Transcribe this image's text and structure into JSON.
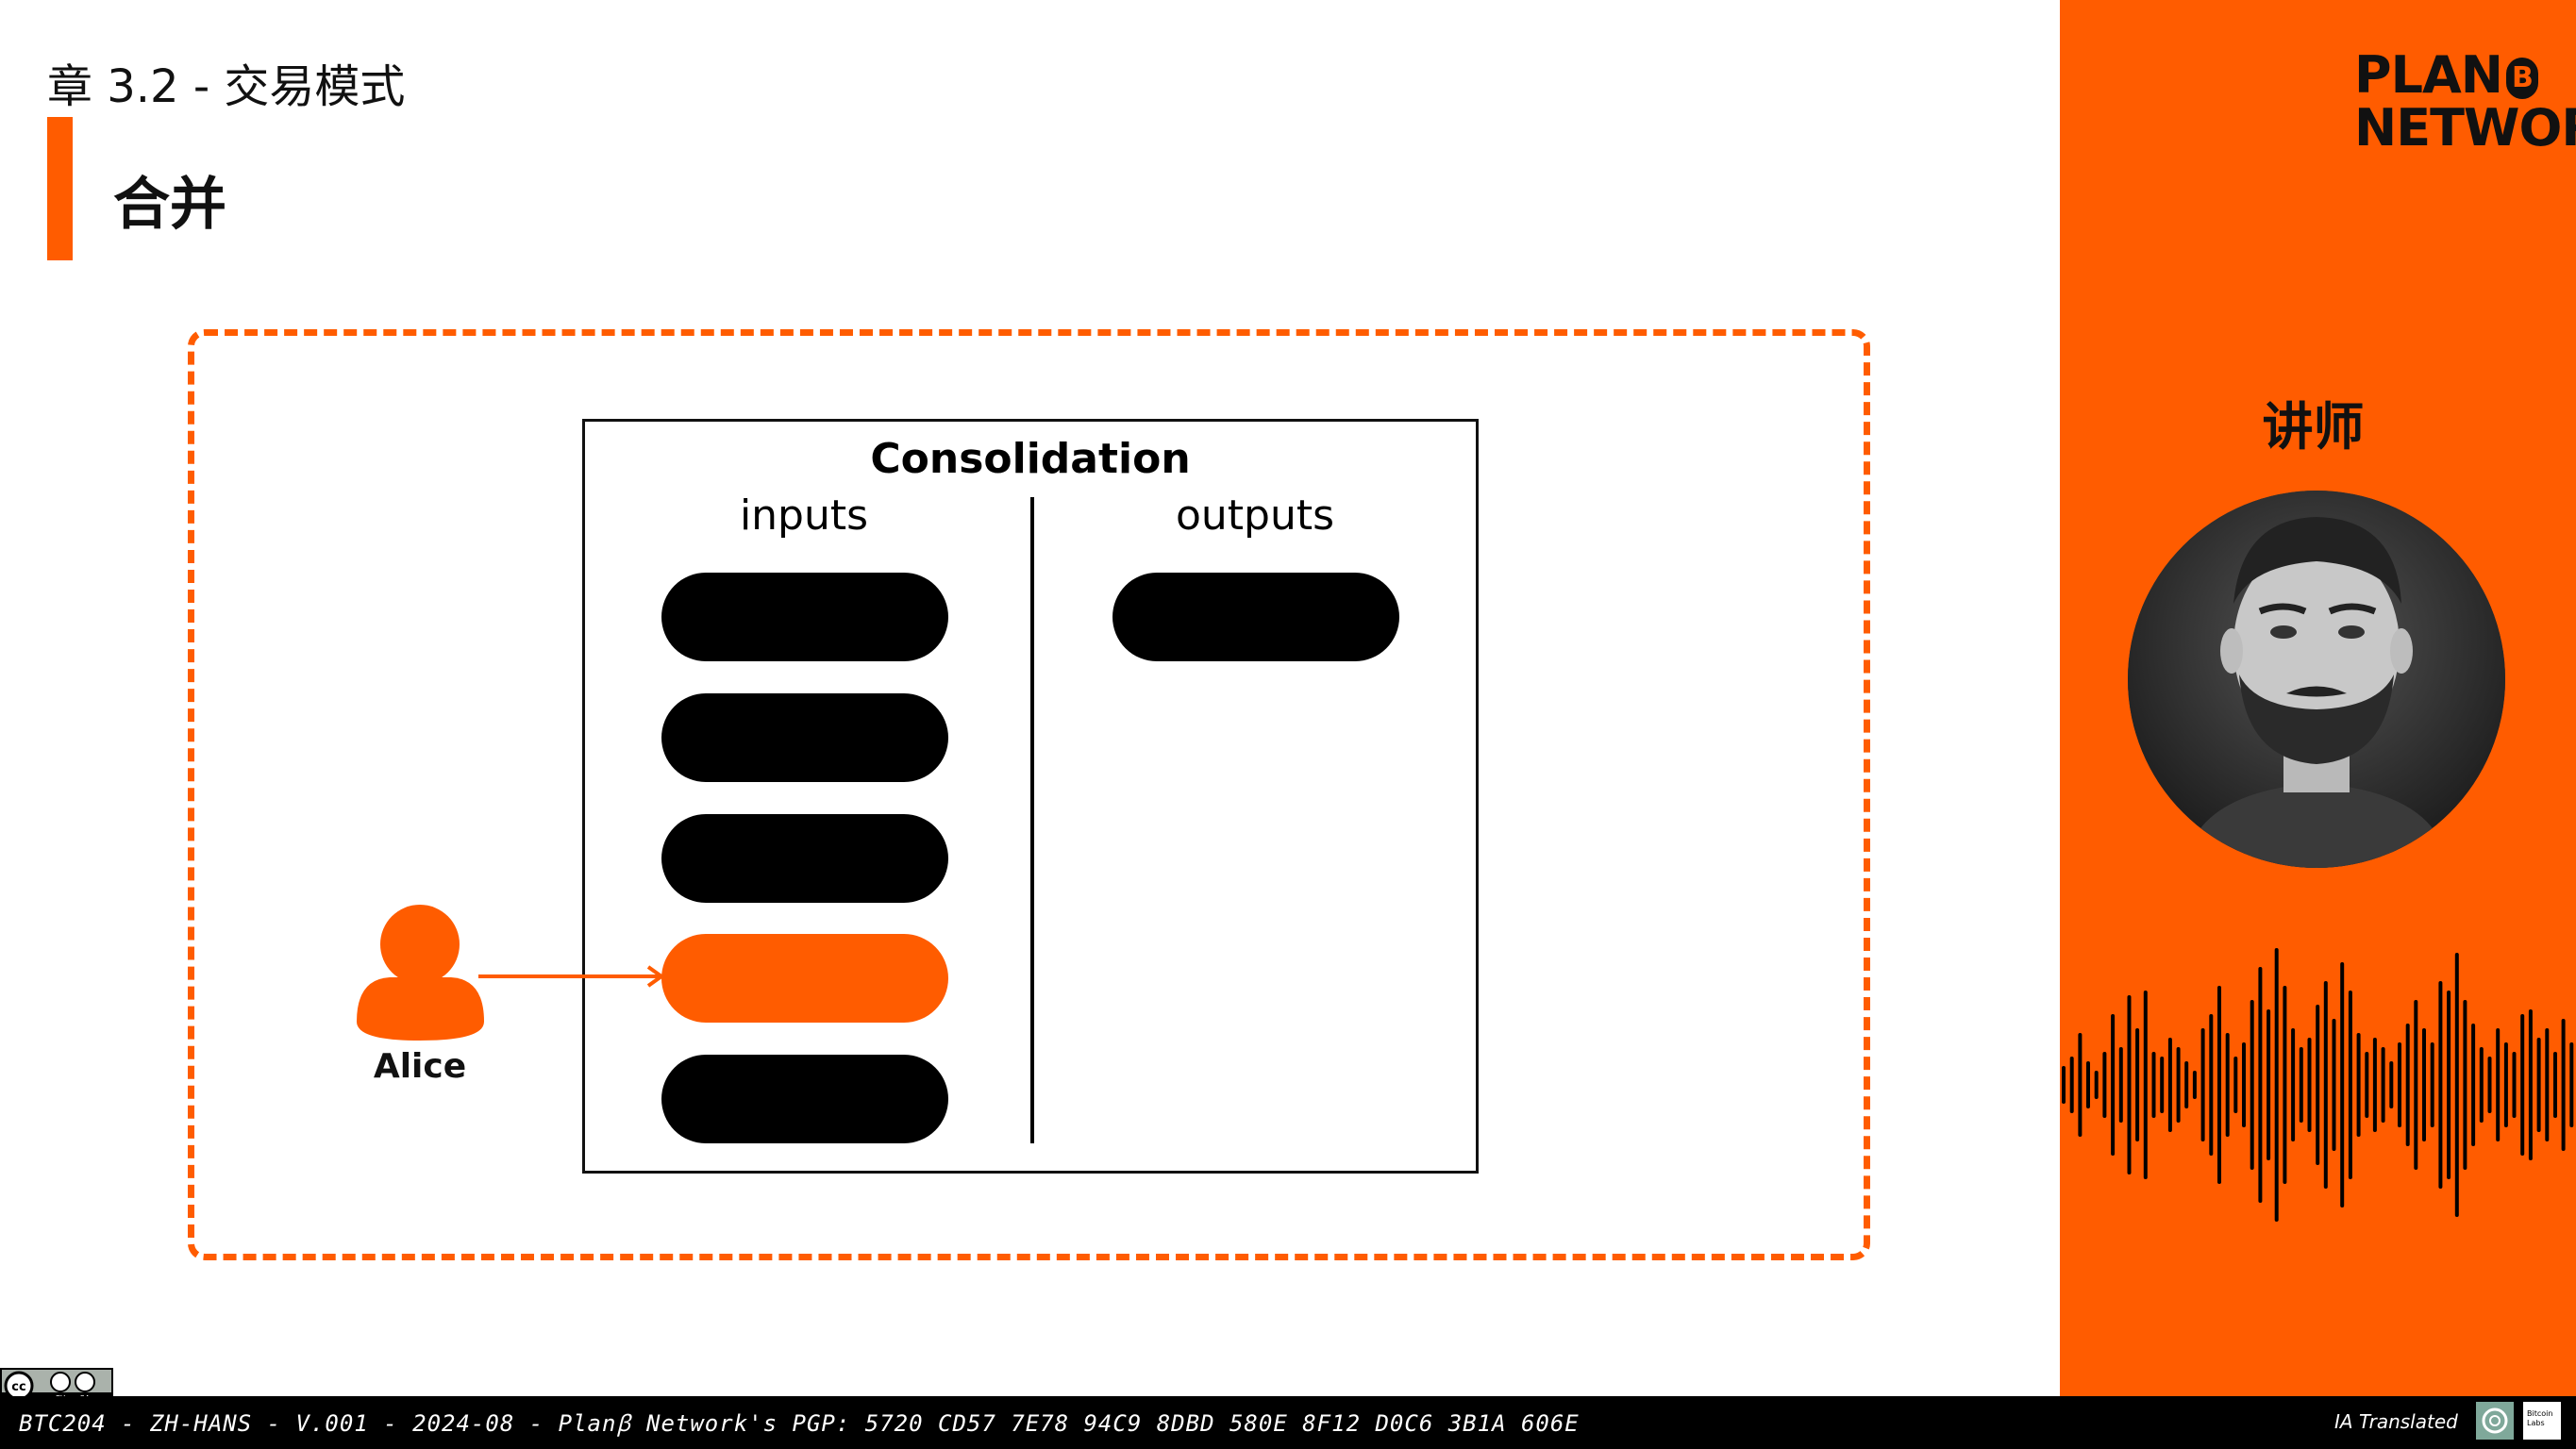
{
  "slide": {
    "chapter": "章 3.2 - 交易模式",
    "section_title": "合并"
  },
  "diagram": {
    "box_title": "Consolidation",
    "inputs_label": "inputs",
    "outputs_label": "outputs",
    "input_count": 5,
    "output_count": 1,
    "highlighted_input_index": 3,
    "owner_name": "Alice",
    "accent_color": "#ff5c00",
    "utxo_color": "#000000"
  },
  "sidebar": {
    "logo_line1": "PLAN",
    "logo_b": "B",
    "logo_line2": "NETWORK",
    "instructor_label": "讲师",
    "background_color": "#ff5c00"
  },
  "footer": {
    "text": "BTC204 - ZH-HANS - V.001 - 2024-08 - Planꞵ Network's PGP: 5720 CD57 7E78 94C9 8DBD 580E 8F12 D0C6 3B1A 606E",
    "ia_text": "IA Translated",
    "lab_text": "Bitcoin Labs"
  },
  "license": {
    "cc_label": "cc",
    "by": "BY",
    "sa": "SA"
  }
}
